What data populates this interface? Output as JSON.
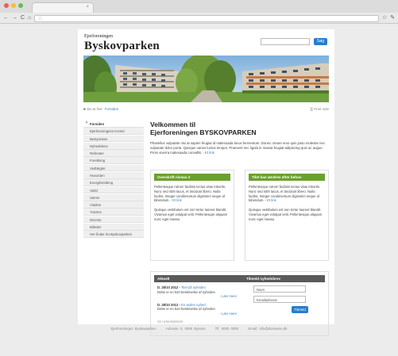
{
  "browser": {
    "tab_title": "",
    "url": "",
    "nav_icons": [
      "back-arrow-icon",
      "forward-arrow-icon",
      "reload-icon",
      "home-icon"
    ]
  },
  "header": {
    "brand_small": "Ejerforeningen",
    "brand_large": "Byskovparken",
    "search_placeholder": "",
    "search_button": "Søg"
  },
  "breadcrumb": {
    "prefix": "Du er her:",
    "current": "Forsiden",
    "print": "Print side"
  },
  "sidebar": {
    "items": [
      {
        "label": "Forsiden",
        "active": true
      },
      {
        "label": "Ejerforeningens Kontor"
      },
      {
        "label": "Bestyrelsen"
      },
      {
        "label": "Nyhedsbrev"
      },
      {
        "label": "Referater"
      },
      {
        "label": "Foreltning"
      },
      {
        "label": "Vedtægter"
      },
      {
        "label": "Husorden"
      },
      {
        "label": "Energiforsåring"
      },
      {
        "label": "Varld"
      },
      {
        "label": "Varme"
      },
      {
        "label": "Viadion"
      },
      {
        "label": "YouSee"
      },
      {
        "label": "Diverse"
      },
      {
        "label": "Billeder"
      },
      {
        "label": "Her finder du Byskovparken"
      }
    ]
  },
  "main": {
    "title_line1": "Velkommen til",
    "title_line2": "Ejerforeningen BYSKOVPARKEN",
    "intro": "Phasellus vulputate nisi at sapien feugiat id malesuada lacus fermentum. Donec ornare eros quis justo molestie nec vulputate dolor porta. Quisque varius luctus tempor. Praesent nec ligula in massa feugiat adipiscing quis ac augue. Proin viverra malesuada convallis.",
    "intro_link": "Et link",
    "box1": {
      "title": "Overskrift niveau 2",
      "p1": "Pellentesque rutrum facilisis lectus vitae lobortis. Nunc sed nibh lacus, et tincidunt libero. Nulla facilisi. Integer condimentum dignissim neque id bibendum.",
      "p1_link": "Et link",
      "p2": "Quisque vestibulum est non tortor laoreet blandit. Vivamus eget volutpat velit. Pellentesque aliquam nunc eget massa."
    },
    "box2": {
      "title": "Tilet kan ændres efter behov",
      "p1": "Pellentesque rutrum facilisis lectus vitae lobortis. Nunc sed nibh lacus, et tincidunt libero. Nulla facilisi. Integer condimentum dignissim neque id bibendum.",
      "p1_link": "Et link",
      "p2": "Quisque vestibulum est non tortor laoreet blandit. Vivamus eget volutpat velit. Pellentesque aliquam nunc eget massa."
    },
    "news": {
      "col1": "Aktuelt",
      "col2": "Tilmeld nyhedsbrev",
      "items": [
        {
          "date": "D. 28/10 2012 -",
          "title": "Titel på nyheden",
          "desc": "Dette er en kort beskrivelse af nyheden",
          "more": "Læs mere"
        },
        {
          "date": "D. 28/10 2012 -",
          "title": "En anden nyhed",
          "desc": "Dette er en kort beskrivelse af nyheden",
          "more": "Læs mere"
        }
      ],
      "all": "Se nyhedsarkivet",
      "name_placeholder": "Navn",
      "email_placeholder": "Emailadresse",
      "submit": "Tilmeld"
    }
  },
  "footer": {
    "org": "Ejerforeningen Byskovparken",
    "address": "Adresse 0, 0000 Byssen",
    "phone": "Tlf. 0000 0000",
    "email": "Email: info@domaene.dk"
  },
  "colors": {
    "accent_blue": "#2b7dc8",
    "box_green": "#6aa12e",
    "news_header": "#5a5a5a"
  }
}
